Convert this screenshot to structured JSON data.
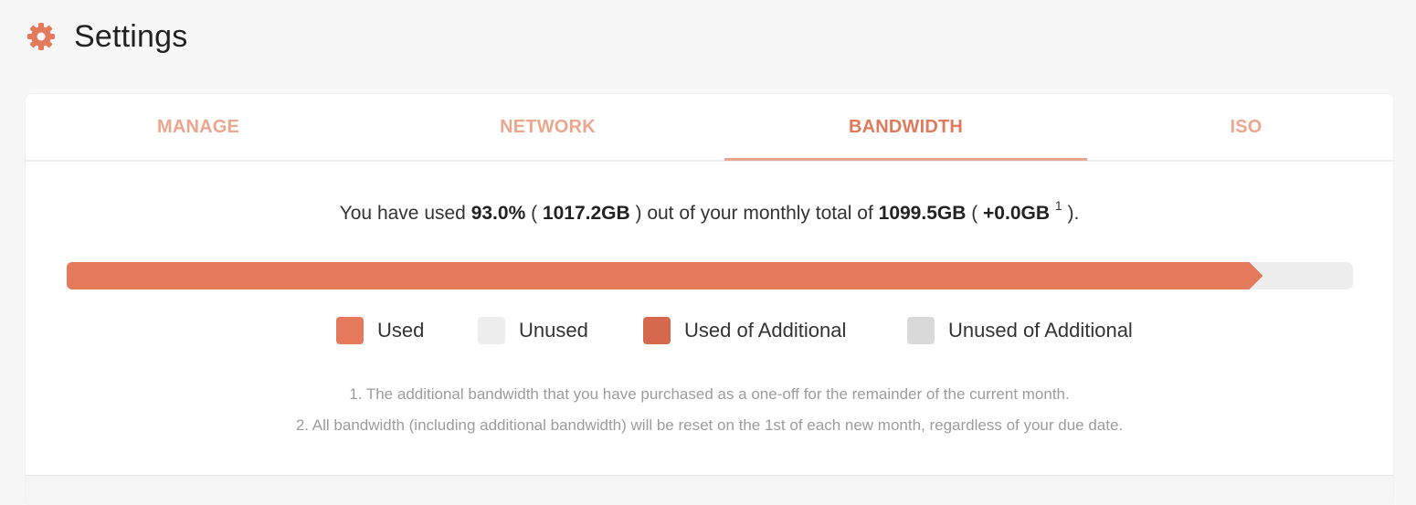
{
  "page": {
    "title": "Settings",
    "icon": "gear-icon"
  },
  "colors": {
    "accent": "#e5795b",
    "tab_inactive": "#eba68e",
    "used": "#e5795b",
    "unused": "#ededed",
    "used_additional": "#d4694d",
    "unused_additional": "#d9d9d9"
  },
  "tabs": [
    {
      "label": "MANAGE",
      "active": false
    },
    {
      "label": "NETWORK",
      "active": false
    },
    {
      "label": "BANDWIDTH",
      "active": true
    },
    {
      "label": "ISO",
      "active": false
    }
  ],
  "bandwidth": {
    "prefix": "You have used",
    "percent": "93.0%",
    "used": "1017.2GB",
    "middle": "out of your monthly total of",
    "total": "1099.5GB",
    "additional": "+0.0GB",
    "footnote_ref": "1",
    "used_fraction": 0.93
  },
  "legend": [
    {
      "label": "Used",
      "color": "#e5795b"
    },
    {
      "label": "Unused",
      "color": "#ededed"
    },
    {
      "label": "Used of Additional",
      "color": "#d4694d"
    },
    {
      "label": "Unused of Additional",
      "color": "#d9d9d9"
    }
  ],
  "notes": [
    "1. The additional bandwidth that you have purchased as a one-off for the remainder of the current month.",
    "2. All bandwidth (including additional bandwidth) will be reset on the 1st of each new month, regardless of your due date."
  ]
}
